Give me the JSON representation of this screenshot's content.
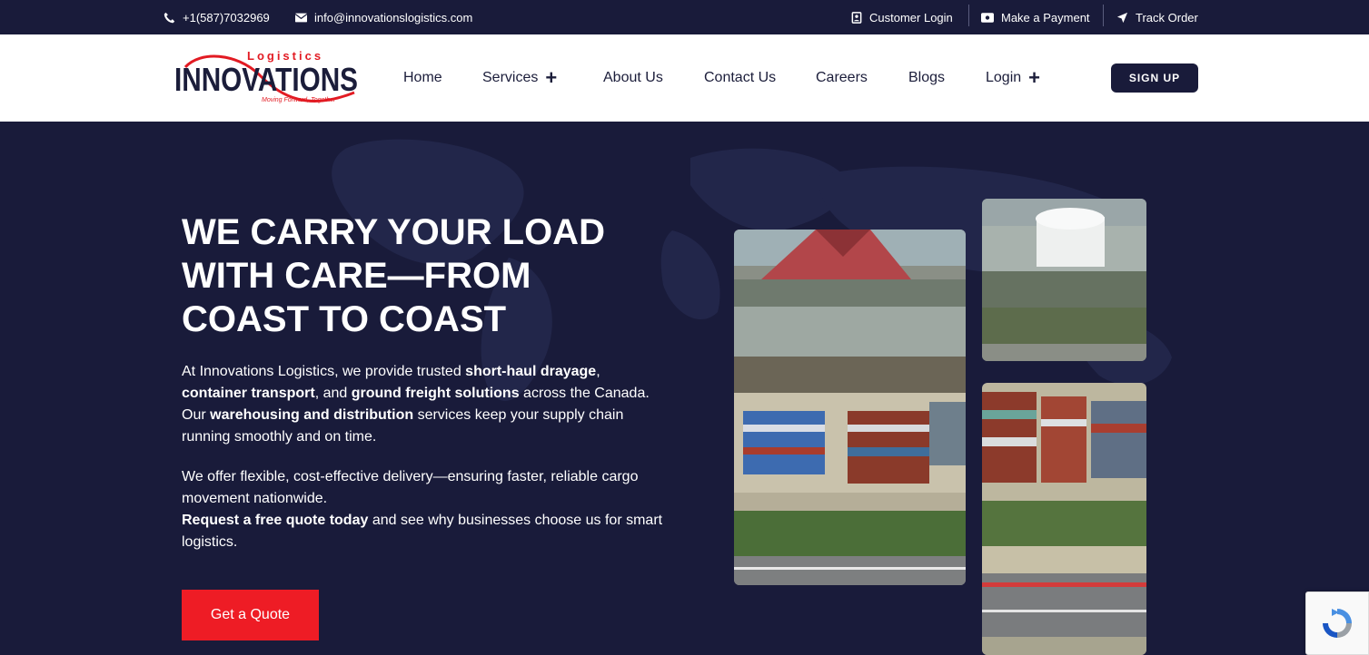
{
  "topbar": {
    "phone": "+1(587)7032969",
    "email": "info@innovationslogistics.com",
    "customer_login": "Customer Login",
    "make_payment": "Make a Payment",
    "track_order": "Track Order"
  },
  "logo": {
    "top_word": "Logistics",
    "main_word": "INNOVATIONS",
    "tagline": "Moving Forward, Together"
  },
  "nav": {
    "home": "Home",
    "services": "Services",
    "about": "About Us",
    "contact": "Contact Us",
    "careers": "Careers",
    "blogs": "Blogs",
    "login": "Login",
    "plus": "+",
    "signup": "SIGN UP"
  },
  "hero": {
    "title_line1": "WE CARRY YOUR LOAD",
    "title_line2": "WITH CARE—FROM",
    "title_line3": "COAST TO COAST",
    "p1": {
      "a": "At Innovations Logistics, we provide trusted ",
      "b": "short-haul drayage",
      "c": ",",
      "d": "container transport",
      "e": ", and ",
      "f": "ground freight solutions",
      "g": " across the Canada.",
      "h": "Our ",
      "i": "warehousing and distribution",
      "j": " services keep your supply chain",
      "k": "running smoothly and on time."
    },
    "p2": {
      "a": "We offer flexible, cost-effective delivery—ensuring faster, reliable cargo",
      "b": "movement nationwide.",
      "c": "Request a free quote today",
      "d": " and see why businesses choose us for smart",
      "e": "logistics."
    },
    "cta": "Get a Quote"
  },
  "colors": {
    "navy": "#191b3a",
    "red": "#ee1c25",
    "white": "#ffffff"
  },
  "icons": [
    "phone-icon",
    "email-icon",
    "customer-login-icon",
    "payment-icon",
    "track-icon",
    "recaptcha-icon"
  ]
}
